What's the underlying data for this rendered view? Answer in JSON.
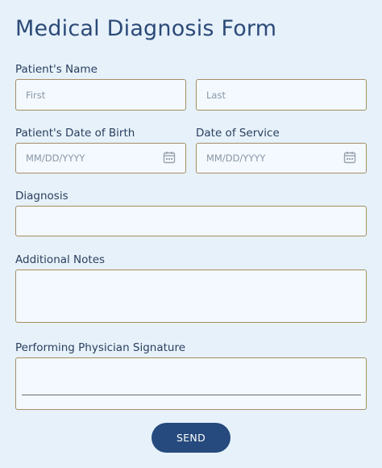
{
  "form": {
    "title": "Medical Diagnosis Form",
    "patient_name_label": "Patient's Name",
    "first_placeholder": "First",
    "last_placeholder": "Last",
    "dob_label": "Patient's Date of Birth",
    "dob_placeholder": "MM/DD/YYYY",
    "service_label": "Date of Service",
    "service_placeholder": "MM/DD/YYYY",
    "diagnosis_label": "Diagnosis",
    "diagnosis_value": "",
    "notes_label": "Additional Notes",
    "notes_value": "",
    "signature_label": "Performing Physician Signature",
    "send_label": "SEND"
  },
  "colors": {
    "background": "#e6f1fa",
    "field_border": "#a68e62",
    "button": "#264a7d",
    "title": "#2c4a78"
  },
  "icons": {
    "dob_icon": "calendar-icon",
    "service_icon": "calendar-icon"
  }
}
